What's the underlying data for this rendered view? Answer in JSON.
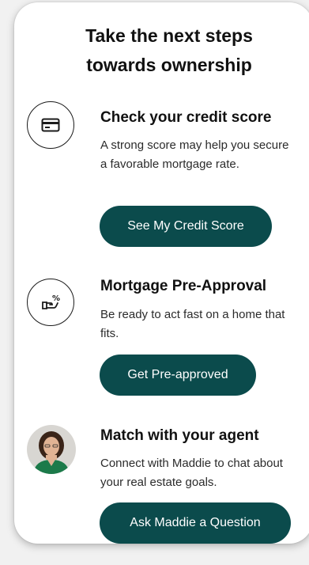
{
  "header": {
    "title_line1": "Take the next steps",
    "title_line2": "towards ownership"
  },
  "steps": [
    {
      "title": "Check your credit score",
      "description": "A strong score may help you secure a favorable mortgage rate.",
      "button_label": "See My Credit Score",
      "icon": "credit-card-icon"
    },
    {
      "title": "Mortgage Pre-Approval",
      "description": "Be ready to act fast on a home that fits.",
      "button_label": "Get Pre-approved",
      "icon": "hand-percent-icon"
    },
    {
      "title": "Match with your agent",
      "description": "Connect with Maddie to chat about your real estate goals.",
      "button_label": "Ask Maddie a Question",
      "icon": "agent-avatar"
    }
  ],
  "colors": {
    "button_bg": "#0b4b4c",
    "button_text": "#ffffff",
    "card_bg": "#ffffff",
    "page_bg": "#f1f1f1"
  }
}
